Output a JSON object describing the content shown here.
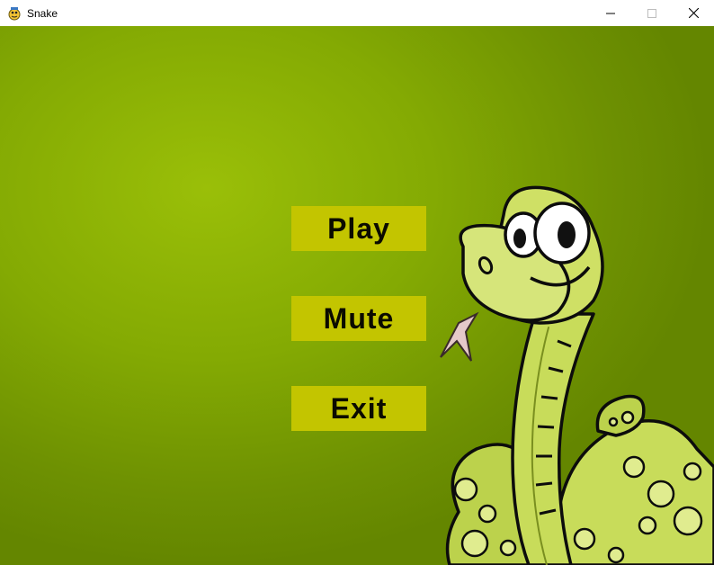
{
  "window": {
    "title": "Snake",
    "icon": "pygame-snake-icon",
    "controls": [
      "minimize-icon",
      "maximize-icon",
      "close-icon"
    ]
  },
  "menu": {
    "play_label": "Play",
    "mute_label": "Mute",
    "exit_label": "Exit"
  },
  "colors": {
    "background": "#84aa03",
    "button": "#c3c500",
    "button_text": "#0b0b00",
    "snake_body": "#c8dc5a",
    "snake_outline": "#0c0c0c"
  }
}
